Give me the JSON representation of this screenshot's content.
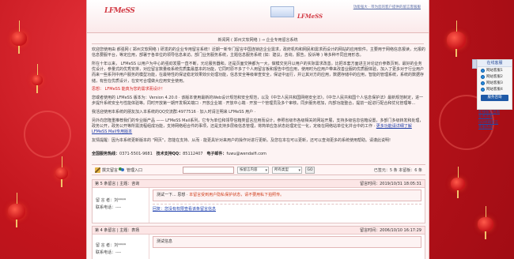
{
  "header": {
    "logo_left": "LFMeSS",
    "logo_right": "LFMeSS",
    "top_link": "功能强大 · 带为您的客户提供的留言客服服",
    "breadcrumb": "新闻网 ( 郑州文软网络 )  → 企业专用留言系统"
  },
  "intro": {
    "p1": "欢迎您使用由  郝强网 ( 郑州文软网络 )  研发的的企业专用留言系统！近期一新专门留言中国连锁店企业需求，政府机构和网民和需求而设计的网站的应用软件。主要用于网络信息报读，允报的信息要服平台，等定应用，部署于各单位的领导信息来访。部门业务服务系统，主题信息服务系统 (如：建议，咨询，报告，投诉等 ) 等多种不同应用形态。",
    "p2": "所在十年以来， LFMeSS 以用户为中心的强劲发展一直不断，元论服务器和，还是页面交换都为一大，做模交完月以用户的实际需求改善，比把本套方面进主对论证价参数页到，最好的业务优设计，参量式的优秀安排，对应留言数量级系统优质集最基本的功能，它同时原不多了个人用留言板和报告中性应用，使用时为应用户带来改善业服的优质服体验，加入了更多对于行业用户而来一些系列中用户服务的模型功能，在最特性的保证稳定效果效价处理功能，信息安全等级审查安全，保证中运行，并让其对方的应用，数据存储中的应用，智能的管理系统，系统的数据存储，有些在优质设计，在安可合理做大应用安全使用。",
    "red_text": "思想： LFMeSS 能真为您的需求而设计！",
    "p3": "您或者使用的 LFMeSS  版本为：Version 4.20.0 · 该版本使用最新的Web设计规范和安全规范，以及《中华人民共和国网络安全法》，《中华人民共和国个人信息保护法》最新规范制定，进一步提升系统安全与性能体验等。同时开放第一期开发相关端口  ·  开放企业端 ·  开放中心端 ·  开放一个管理员及多个审核，同步服务增加，内部功能整合，提前一起进行配合和优化管理等…",
    "p4": "我活迎使用本系统的朋友加入本系统的QQ交流群:4977516 · 加入时请注明来 LFMeSS 用户 ·",
    "p5_a": "另外向您隆重推荐我们的专业版产品 —— LFMeSS Mail系列，它专为单位和领导信箱类留言应用而设计，参照省级市各级相关的网站开展，支持多级信息信箱设置，多部门多级转发和处理，政务公开，政务公开等所需流程组成功能，支持网络组合件的事项，还是支持多层级信息管理，将简单应急状态处理定位一化，定级在网络站单位化并合中的工作  ·  ",
    "p5_b": "更多功能请详细了解 LFMeSS Mail专用版本",
    "p6": "友情提醒：因为本系统更新版本的 \"网页\"，您能在支持、从而 ·  能更具针对来用户的操作对进行更新。及您在本在可以更新，还可以查询更多的系统使用帮助。请谨此说明!"
  },
  "contact": {
    "hotline_label": "全国服务热线：",
    "hotline": "0371-5501-9681",
    "qq_label": "技术支持QQ：",
    "qq": "85112407",
    "email_label": "电子邮件：",
    "email": "fuwu@wendaifi.com"
  },
  "toolbar": {
    "post_label": "撰文留言",
    "admin_label": "管理入口",
    "search_placeholder": "",
    "type_select": "按留言内容",
    "scope_select": "所有类型",
    "go_label": "GO",
    "stats": "已签元：5 条  本留板：6 条"
  },
  "messages": [
    {
      "head": "第 5 条留言  | 主题：咨询",
      "time": "留言时间：2019/10/31 18:05:31",
      "name_label": "留 言 者：",
      "name": "刘****",
      "contact_label": "联系电话：",
      "contact": "----",
      "bubble_prefix": "测试一下... 思想 ·",
      "bubble_red": "本留言受到用户隐私保护状态，请不要用私下拍照传。",
      "reply_label": "回复：",
      "reply": "您没有权限查看该条留言信息",
      "foot": "回复时间：…"
    },
    {
      "head": "第 4 条留言  | 主题：表扬",
      "time": "留言时间：2006/10/10 16:17:29",
      "name_label": "留 言 者：",
      "name": "刘****",
      "contact_label": "联系电话：",
      "contact": "----",
      "bubble_prefix": "测试信息",
      "bubble_red": "",
      "reply_label": "",
      "reply": "",
      "foot": ""
    }
  ],
  "side_panel": {
    "title": "在线客服",
    "items": [
      "网站客服1",
      "网站客服2",
      "网站客服3",
      "网站客服4"
    ],
    "service_btn": "服务咨询",
    "links": [
      "在线留言咨询",
      "业务咨询",
      "QQ邮箱留言",
      "客服热线"
    ]
  }
}
